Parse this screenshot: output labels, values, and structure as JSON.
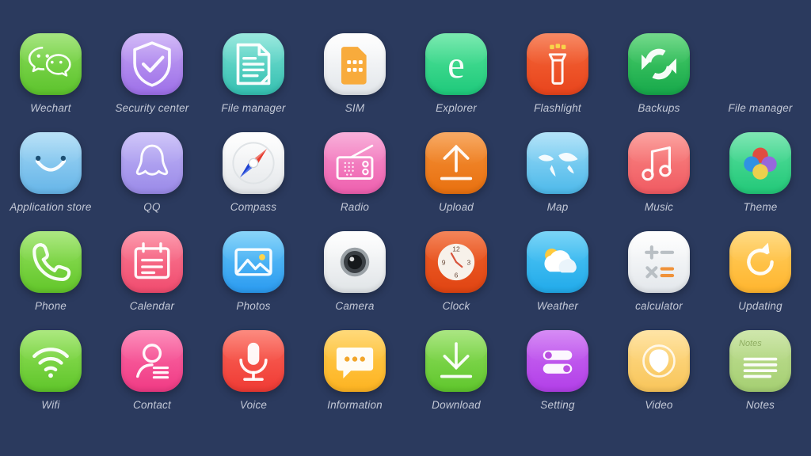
{
  "screen": {
    "background_color": "#2b3a5e",
    "label_color": "#c3c8d6",
    "rows": 4,
    "columns": 8
  },
  "apps": [
    {
      "label": "Wechart",
      "icon": "wechat-icon",
      "colors": {
        "top": "#8ede5e",
        "bottom": "#5cc32c"
      }
    },
    {
      "label": "Security  center",
      "icon": "shield-check-icon",
      "colors": {
        "top": "#c6a8f5",
        "bottom": "#9d6fe8"
      }
    },
    {
      "label": "File manager",
      "icon": "document-icon",
      "colors": {
        "top": "#7fe3d6",
        "bottom": "#34bfb0"
      }
    },
    {
      "label": "SIM",
      "icon": "sim-card-icon",
      "colors": {
        "top": "#ffffff",
        "bottom": "#e2e6ea"
      }
    },
    {
      "label": "Explorer",
      "icon": "edge-e-icon",
      "colors": {
        "top": "#57e49b",
        "bottom": "#1ec97b"
      }
    },
    {
      "label": "Flashlight",
      "icon": "flashlight-icon",
      "colors": {
        "top": "#f5693a",
        "bottom": "#e8441c"
      }
    },
    {
      "label": "Backups",
      "icon": "sync-arrows-icon",
      "colors": {
        "top": "#4ed06c",
        "bottom": "#16a84a"
      }
    },
    {
      "label": "File manager",
      "icon": "none",
      "colors": {
        "top": "#2b3a5e",
        "bottom": "#2b3a5e"
      },
      "empty": true
    },
    {
      "label": "Application store",
      "icon": "shopping-bag-icon",
      "colors": {
        "top": "#a6d9f5",
        "bottom": "#66b5e8"
      }
    },
    {
      "label": "QQ",
      "icon": "penguin-icon",
      "colors": {
        "top": "#c2b6f7",
        "bottom": "#9a8ae8"
      }
    },
    {
      "label": "Compass",
      "icon": "compass-needle-icon",
      "colors": {
        "top": "#ffffff",
        "bottom": "#e4e7ea"
      }
    },
    {
      "label": "Radio",
      "icon": "radio-icon",
      "colors": {
        "top": "#f79ad0",
        "bottom": "#ee5fae"
      }
    },
    {
      "label": "Upload",
      "icon": "upload-arrow-icon",
      "colors": {
        "top": "#f5923a",
        "bottom": "#e8700f"
      }
    },
    {
      "label": "Map",
      "icon": "world-map-icon",
      "colors": {
        "top": "#9fdcf7",
        "bottom": "#4db9ea"
      }
    },
    {
      "label": "Music",
      "icon": "music-note-icon",
      "colors": {
        "top": "#fa8a86",
        "bottom": "#f05a62"
      }
    },
    {
      "label": "Theme",
      "icon": "color-circles-icon",
      "colors": {
        "top": "#5ce0a0",
        "bottom": "#22c878"
      }
    },
    {
      "label": "Phone",
      "icon": "phone-handset-icon",
      "colors": {
        "top": "#96e260",
        "bottom": "#62c62a"
      }
    },
    {
      "label": "Calendar",
      "icon": "calendar-icon",
      "colors": {
        "top": "#fb8098",
        "bottom": "#f04b6e"
      }
    },
    {
      "label": "Photos",
      "icon": "photo-image-icon",
      "colors": {
        "top": "#69c9f8",
        "bottom": "#2a9af0"
      }
    },
    {
      "label": "Camera",
      "icon": "camera-lens-icon",
      "colors": {
        "top": "#ffffff",
        "bottom": "#e0e4e7"
      }
    },
    {
      "label": "Clock",
      "icon": "analog-clock-icon",
      "colors": {
        "top": "#f0632c",
        "bottom": "#e04412"
      }
    },
    {
      "label": "Weather",
      "icon": "sun-cloud-icon",
      "colors": {
        "top": "#56c9f5",
        "bottom": "#21aaea"
      }
    },
    {
      "label": "calculator",
      "icon": "calculator-icon",
      "colors": {
        "top": "#ffffff",
        "bottom": "#e3e7eb"
      }
    },
    {
      "label": "Updating",
      "icon": "refresh-arrow-icon",
      "colors": {
        "top": "#ffd062",
        "bottom": "#ffb52e"
      }
    },
    {
      "label": "Wifi",
      "icon": "wifi-icon",
      "colors": {
        "top": "#95e25c",
        "bottom": "#5fc52a"
      }
    },
    {
      "label": "Contact",
      "icon": "contact-person-icon",
      "colors": {
        "top": "#fb6fa8",
        "bottom": "#f03a84"
      }
    },
    {
      "label": "Voice",
      "icon": "microphone-icon",
      "colors": {
        "top": "#fb6a5c",
        "bottom": "#ef3a34"
      }
    },
    {
      "label": "Information",
      "icon": "chat-bubble-icon",
      "colors": {
        "top": "#ffcf55",
        "bottom": "#fdb321"
      }
    },
    {
      "label": "Download",
      "icon": "download-arrow-icon",
      "colors": {
        "top": "#93df60",
        "bottom": "#5fc62c"
      }
    },
    {
      "label": "Setting",
      "icon": "toggles-icon",
      "colors": {
        "top": "#cb6cf2",
        "bottom": "#b23fe8"
      }
    },
    {
      "label": "Video",
      "icon": "play-shield-icon",
      "colors": {
        "top": "#ffdd8e",
        "bottom": "#f8c55a"
      }
    },
    {
      "label": "Notes",
      "icon": "notes-lines-icon",
      "colors": {
        "top": "#c2e096",
        "bottom": "#a5cf72"
      },
      "inner_text": "Notes"
    }
  ]
}
